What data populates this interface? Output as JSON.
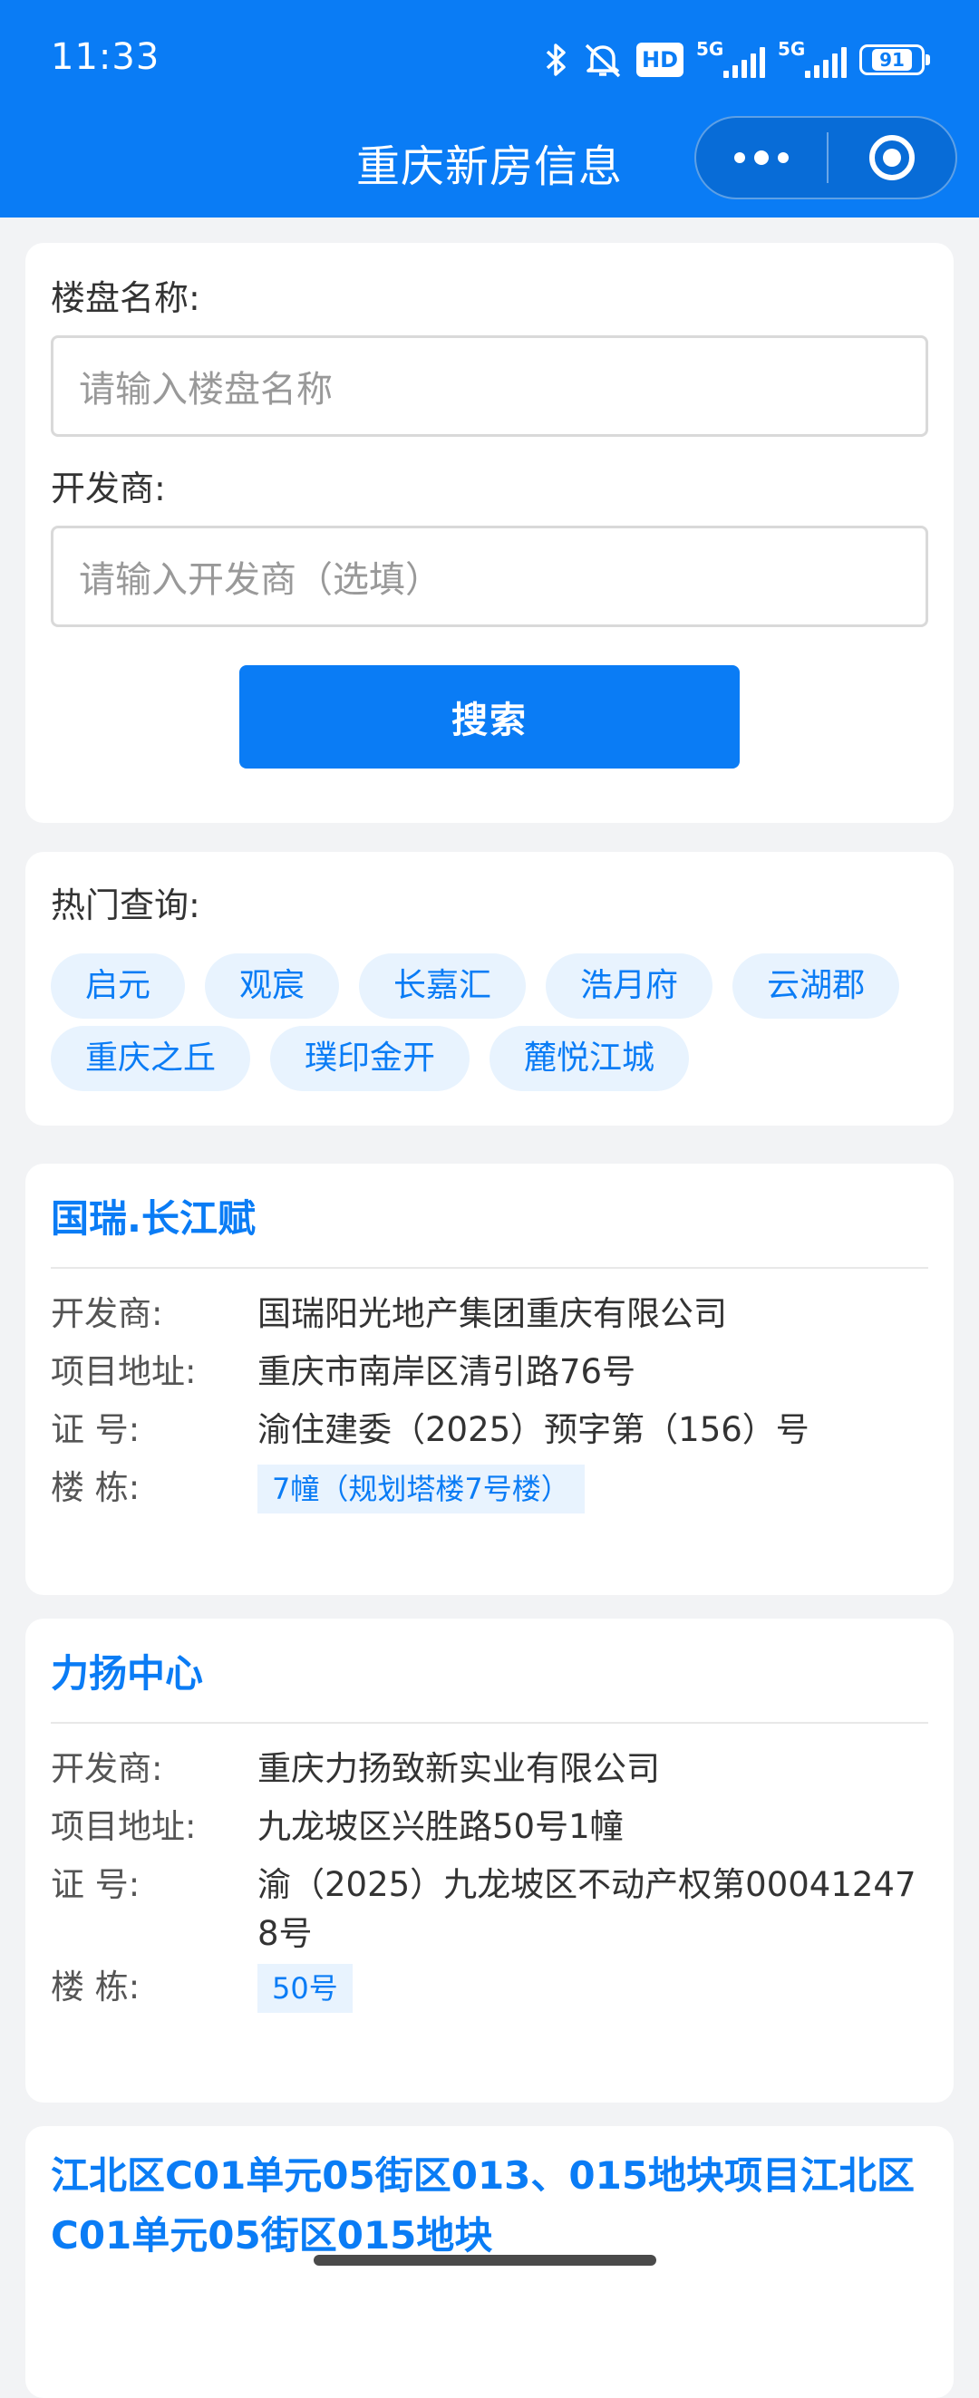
{
  "status_bar": {
    "time": "11:33",
    "hd_label": "HD",
    "sig1_label": "5G",
    "sig2_label": "5G",
    "battery": "91"
  },
  "header": {
    "title": "重庆新房信息"
  },
  "search": {
    "name_label": "楼盘名称:",
    "name_placeholder": "请输入楼盘名称",
    "dev_label": "开发商:",
    "dev_placeholder": "请输入开发商（选填）",
    "button": "搜索"
  },
  "hot": {
    "label": "热门查询:",
    "tags": [
      "启元",
      "观宸",
      "长嘉汇",
      "浩月府",
      "云湖郡",
      "重庆之丘",
      "璞印金开",
      "麓悦江城"
    ]
  },
  "field_labels": {
    "developer": "开发商:",
    "address": "项目地址:",
    "license": "证  号:",
    "building": "楼  栋:"
  },
  "results": [
    {
      "name": "国瑞.长江赋",
      "developer": "国瑞阳光地产集团重庆有限公司",
      "address": "重庆市南岸区清引路76号",
      "license": "渝住建委（2025）预字第（156）号",
      "building": "7幢（规划塔楼7号楼）"
    },
    {
      "name": "力扬中心",
      "developer": "重庆力扬致新实业有限公司",
      "address": "九龙坡区兴胜路50号1幢",
      "license": "渝（2025）九龙坡区不动产权第000412478号",
      "building": "50号"
    },
    {
      "name": "江北区C01单元05街区013、015地块项目江北区C01单元05街区015地块"
    }
  ]
}
